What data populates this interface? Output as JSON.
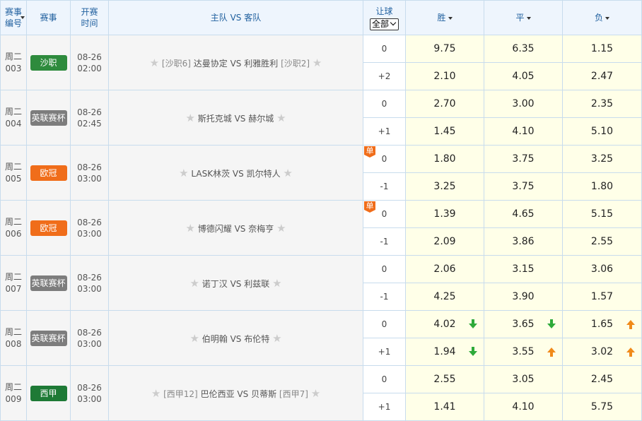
{
  "header": {
    "col_id": "赛事编号",
    "col_league": "赛事",
    "col_time": "开赛时间",
    "col_match": "主队 VS 客队",
    "col_handicap": "让球",
    "handicap_select": "全部",
    "col_win": "胜",
    "col_draw": "平",
    "col_lose": "负"
  },
  "colors": {
    "沙职": "#2e8b3d",
    "英联赛杯": "#7d7d7d",
    "欧冠": "#f06d1a",
    "西甲": "#1e7a36",
    "arrow_down": "#2eaa3a",
    "arrow_up": "#f08a1a"
  },
  "rows": [
    {
      "weekday": "周二",
      "num": "003",
      "league": "沙职",
      "date": "08-26",
      "time": "02:00",
      "home_rank": "[沙职6]",
      "home": "达曼协定",
      "vs": "VS",
      "away": "利雅胜利",
      "away_rank": "[沙职2]",
      "single": "",
      "lines": [
        {
          "hc": "0",
          "odds": [
            "9.75",
            "6.35",
            "1.15"
          ],
          "arrows": [
            "",
            "",
            ""
          ]
        },
        {
          "hc": "+2",
          "odds": [
            "2.10",
            "4.05",
            "2.47"
          ],
          "arrows": [
            "",
            "",
            ""
          ]
        }
      ]
    },
    {
      "weekday": "周二",
      "num": "004",
      "league": "英联赛杯",
      "date": "08-26",
      "time": "02:45",
      "home_rank": "",
      "home": "斯托克城",
      "vs": "VS",
      "away": "赫尔城",
      "away_rank": "",
      "single": "",
      "lines": [
        {
          "hc": "0",
          "odds": [
            "2.70",
            "3.00",
            "2.35"
          ],
          "arrows": [
            "",
            "",
            ""
          ]
        },
        {
          "hc": "+1",
          "odds": [
            "1.45",
            "4.10",
            "5.10"
          ],
          "arrows": [
            "",
            "",
            ""
          ]
        }
      ]
    },
    {
      "weekday": "周二",
      "num": "005",
      "league": "欧冠",
      "date": "08-26",
      "time": "03:00",
      "home_rank": "",
      "home": "LASK林茨",
      "vs": "VS",
      "away": "凯尔特人",
      "away_rank": "",
      "single": "单",
      "lines": [
        {
          "hc": "0",
          "odds": [
            "1.80",
            "3.75",
            "3.25"
          ],
          "arrows": [
            "",
            "",
            ""
          ]
        },
        {
          "hc": "-1",
          "odds": [
            "3.25",
            "3.75",
            "1.80"
          ],
          "arrows": [
            "",
            "",
            ""
          ]
        }
      ]
    },
    {
      "weekday": "周二",
      "num": "006",
      "league": "欧冠",
      "date": "08-26",
      "time": "03:00",
      "home_rank": "",
      "home": "博德闪耀",
      "vs": "VS",
      "away": "奈梅亨",
      "away_rank": "",
      "single": "单",
      "lines": [
        {
          "hc": "0",
          "odds": [
            "1.39",
            "4.65",
            "5.15"
          ],
          "arrows": [
            "",
            "",
            ""
          ]
        },
        {
          "hc": "-1",
          "odds": [
            "2.09",
            "3.86",
            "2.55"
          ],
          "arrows": [
            "",
            "",
            ""
          ]
        }
      ]
    },
    {
      "weekday": "周二",
      "num": "007",
      "league": "英联赛杯",
      "date": "08-26",
      "time": "03:00",
      "home_rank": "",
      "home": "诺丁汉",
      "vs": "VS",
      "away": "利兹联",
      "away_rank": "",
      "single": "",
      "lines": [
        {
          "hc": "0",
          "odds": [
            "2.06",
            "3.15",
            "3.06"
          ],
          "arrows": [
            "",
            "",
            ""
          ]
        },
        {
          "hc": "-1",
          "odds": [
            "4.25",
            "3.90",
            "1.57"
          ],
          "arrows": [
            "",
            "",
            ""
          ]
        }
      ]
    },
    {
      "weekday": "周二",
      "num": "008",
      "league": "英联赛杯",
      "date": "08-26",
      "time": "03:00",
      "home_rank": "",
      "home": "伯明翰",
      "vs": "VS",
      "away": "布伦特",
      "away_rank": "",
      "single": "",
      "lines": [
        {
          "hc": "0",
          "odds": [
            "4.02",
            "3.65",
            "1.65"
          ],
          "arrows": [
            "down",
            "down",
            "up"
          ]
        },
        {
          "hc": "+1",
          "odds": [
            "1.94",
            "3.55",
            "3.02"
          ],
          "arrows": [
            "down",
            "up",
            "up"
          ]
        }
      ]
    },
    {
      "weekday": "周二",
      "num": "009",
      "league": "西甲",
      "date": "08-26",
      "time": "03:00",
      "home_rank": "[西甲12]",
      "home": "巴伦西亚",
      "vs": "VS",
      "away": "贝蒂斯",
      "away_rank": "[西甲7]",
      "single": "",
      "lines": [
        {
          "hc": "0",
          "odds": [
            "2.55",
            "3.05",
            "2.45"
          ],
          "arrows": [
            "",
            "",
            ""
          ]
        },
        {
          "hc": "+1",
          "odds": [
            "1.41",
            "4.10",
            "5.75"
          ],
          "arrows": [
            "",
            "",
            ""
          ]
        }
      ]
    }
  ]
}
